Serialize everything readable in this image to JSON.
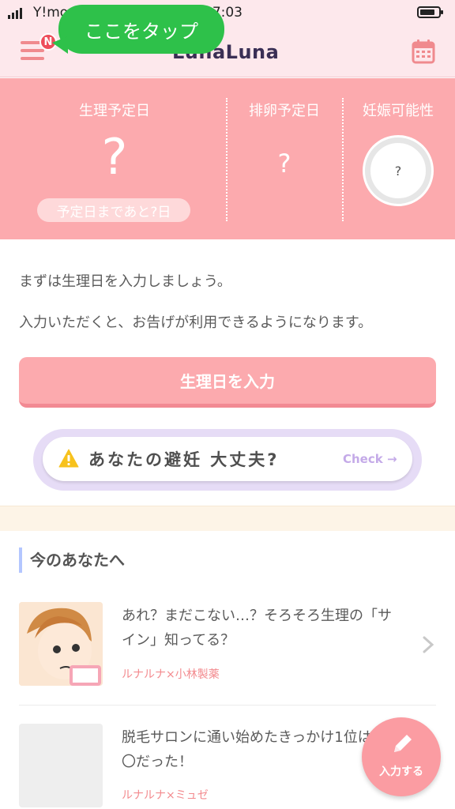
{
  "status_bar": {
    "carrier": "Y!mo",
    "time": "17:03"
  },
  "header": {
    "logo": "LunaLuna",
    "notification_badge": "N",
    "tooltip": "ここをタップ"
  },
  "predictions": {
    "period": {
      "title": "生理予定日",
      "value": "?",
      "remaining": "予定日まであと?日"
    },
    "ovulation": {
      "title": "排卵予定日",
      "value": "?"
    },
    "pregnancy": {
      "title": "妊娠可能性",
      "value": "?"
    }
  },
  "intro": {
    "line1": "まずは生理日を入力しましょう。",
    "line2": "入力いただくと、お告げが利用できるようになります。",
    "input_button": "生理日を入力"
  },
  "check_banner": {
    "text": "あなたの避妊 大丈夫?",
    "link": "Check →"
  },
  "section": {
    "title": "今のあなたへ"
  },
  "articles": [
    {
      "title": "あれ？まだこない…？そろそろ生理の「サイン」知ってる？",
      "source": "ルナルナ×小林製薬"
    },
    {
      "title": "脱毛サロンに通い始めたきっかけ1位は〇〇だった！",
      "source": "ルナルナ×ミュゼ"
    }
  ],
  "fab": {
    "label": "入力する"
  },
  "colors": {
    "primary_pink": "#fcaaae",
    "header_bg": "#fde8ec",
    "tooltip_green": "#2ec14a",
    "source_pink": "#f38b8f"
  }
}
